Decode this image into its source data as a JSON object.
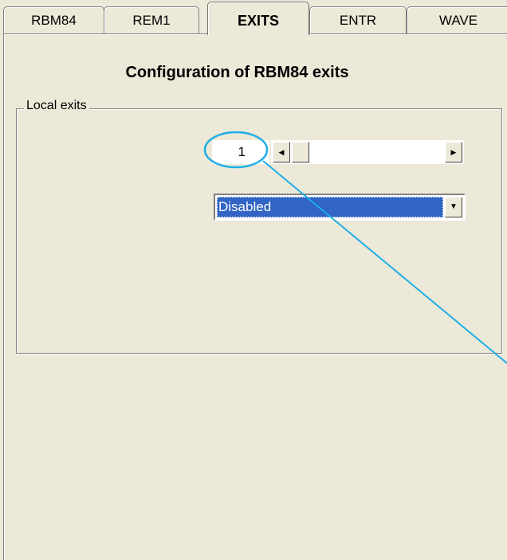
{
  "tabs": [
    {
      "label": "RBM84"
    },
    {
      "label": "REM1"
    },
    {
      "label": "EXITS"
    },
    {
      "label": "ENTR"
    },
    {
      "label": "WAVE"
    }
  ],
  "heading": "Configuration of RBM84 exits",
  "group": {
    "label": "Local exits"
  },
  "exit_selector": {
    "value": "1"
  },
  "mode_select": {
    "value": "Disabled"
  },
  "colors": {
    "accent": "#3164c4",
    "annotation": "#1eaee6",
    "background": "#ece9d8"
  },
  "icons": {
    "scroll_left": "triangle-left",
    "scroll_right": "triangle-right",
    "dropdown": "triangle-down"
  }
}
